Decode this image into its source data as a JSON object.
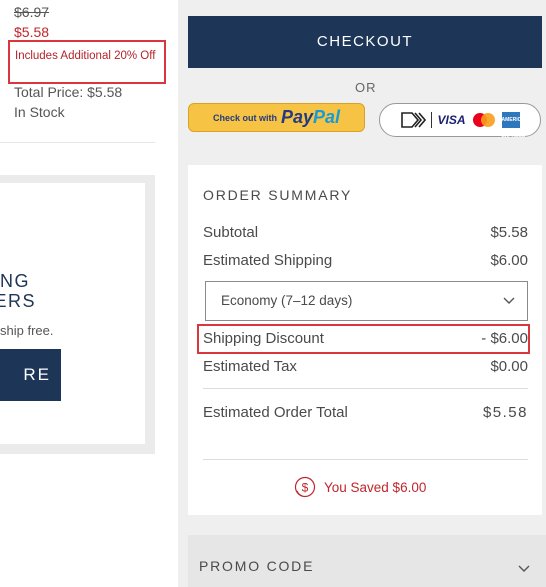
{
  "product": {
    "original_price": "$6.97",
    "sale_price": "$5.58",
    "promo_note": "Includes Additional 20% Off",
    "total_price": "Total Price: $5.58",
    "stock_status": "In Stock"
  },
  "banner": {
    "line1": "PING",
    "line2": "DERS",
    "subtext": "ship free.",
    "button_label": "RE"
  },
  "checkout": {
    "button_label": "CHECKOUT",
    "or_text": "OR",
    "paypal_small": "Check out with",
    "paypal_pay": "Pay",
    "paypal_pal": "Pal",
    "cards_visa": "VISA",
    "cards_amex": "AMERICAN EXPRESS"
  },
  "summary": {
    "title": "ORDER SUMMARY",
    "subtotal_label": "Subtotal",
    "subtotal_value": "$5.58",
    "shipping_label": "Estimated Shipping",
    "shipping_value": "$6.00",
    "shipping_option": "Economy (7–12 days)",
    "discount_label": "Shipping Discount",
    "discount_value": "- $6.00",
    "tax_label": "Estimated Tax",
    "tax_value": "$0.00",
    "total_label": "Estimated Order Total",
    "total_value": "$5.58",
    "saved_text": "You Saved $6.00"
  },
  "promo": {
    "label": "PROMO CODE"
  },
  "colors": {
    "navy": "#1d3557",
    "sale_red": "#c0262d",
    "highlight_red": "#d9373d",
    "paypal_yellow": "#f7c344"
  }
}
